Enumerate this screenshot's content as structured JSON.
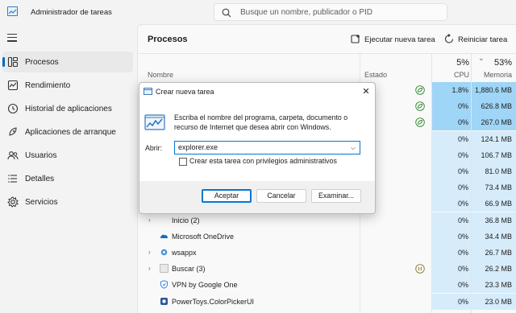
{
  "app": {
    "title": "Administrador de tareas",
    "search_placeholder": "Busque un nombre, publicador o PID"
  },
  "sidebar": {
    "items": [
      {
        "label": "Procesos",
        "icon": "processes-icon",
        "active": true
      },
      {
        "label": "Rendimiento",
        "icon": "performance-icon"
      },
      {
        "label": "Historial de aplicaciones",
        "icon": "history-icon"
      },
      {
        "label": "Aplicaciones de arranque",
        "icon": "startup-icon"
      },
      {
        "label": "Usuarios",
        "icon": "users-icon"
      },
      {
        "label": "Detalles",
        "icon": "details-icon"
      },
      {
        "label": "Servicios",
        "icon": "services-icon"
      }
    ]
  },
  "main": {
    "title": "Procesos",
    "new_task_label": "Ejecutar nueva tarea",
    "restart_label": "Reiniciar tarea",
    "columns": {
      "name": "Nombre",
      "status": "Estado",
      "cpu_pct": "5%",
      "cpu_label": "CPU",
      "mem_pct": "53%",
      "mem_label": "Memoria"
    },
    "rows": [
      {
        "name": "",
        "cpu": "1.8%",
        "mem": "1,880.6 MB",
        "status_icon": "leaf-icon"
      },
      {
        "name": "",
        "cpu": "0%",
        "mem": "626.8 MB",
        "status_icon": "leaf-icon"
      },
      {
        "name": "",
        "cpu": "0%",
        "mem": "267.0 MB",
        "status_icon": "leaf-icon"
      },
      {
        "name": "",
        "cpu": "0%",
        "mem": "124.1 MB"
      },
      {
        "name": "",
        "cpu": "0%",
        "mem": "106.7 MB"
      },
      {
        "name": "",
        "cpu": "0%",
        "mem": "81.0 MB"
      },
      {
        "name": "",
        "cpu": "0%",
        "mem": "73.4 MB"
      },
      {
        "name": "",
        "cpu": "0%",
        "mem": "66.9 MB"
      },
      {
        "name": "Inicio (2)",
        "cpu": "0%",
        "mem": "36.8 MB",
        "expandable": true
      },
      {
        "name": "Microsoft OneDrive",
        "cpu": "0%",
        "mem": "34.4 MB",
        "icon": "onedrive-icon"
      },
      {
        "name": "wsappx",
        "cpu": "0%",
        "mem": "26.7 MB",
        "expandable": true,
        "icon": "gear-icon"
      },
      {
        "name": "Buscar (3)",
        "cpu": "0%",
        "mem": "26.2 MB",
        "expandable": true,
        "icon": "search-app-icon",
        "status_icon": "pause-icon"
      },
      {
        "name": "VPN by Google One",
        "cpu": "0%",
        "mem": "23.3 MB",
        "icon": "vpn-icon"
      },
      {
        "name": "PowerToys.ColorPickerUI",
        "cpu": "0%",
        "mem": "23.0 MB",
        "icon": "colorpicker-icon"
      }
    ]
  },
  "dialog": {
    "title": "Crear nueva tarea",
    "description": "Escriba el nombre del programa, carpeta, documento o recurso de Internet que desea abrir con Windows.",
    "open_label": "Abrir:",
    "input_value": "explorer.exe",
    "admin_checkbox_label": "Crear esta tarea con privilegios administrativos",
    "ok_label": "Aceptar",
    "cancel_label": "Cancelar",
    "browse_label": "Examinar...",
    "close_glyph": "✕"
  },
  "colors": {
    "accent": "#0078d4",
    "cpu_heat_high": "#9fd5f7",
    "cpu_heat_low": "#d6ecfb",
    "mem_heat_high": "#9fd5f7",
    "mem_heat_low": "#d6ecfb"
  }
}
